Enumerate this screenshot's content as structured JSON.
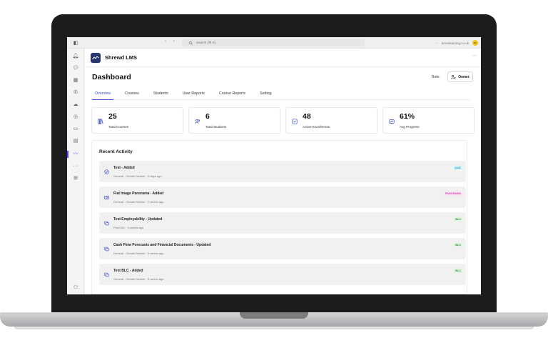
{
  "browser": {
    "search_placeholder": "Search (⌘ E)",
    "url": "leruelearning.co.uk",
    "avatar_initials": "SY",
    "nav_arrows": "‹ ›",
    "more": "···"
  },
  "app": {
    "name": "Shrewd LMS",
    "more": "···"
  },
  "page": {
    "title": "Dashboard",
    "role_label": "Role:",
    "role_value": "Owner"
  },
  "tabs": [
    {
      "label": "Overview",
      "active": true
    },
    {
      "label": "Courses",
      "active": false
    },
    {
      "label": "Students",
      "active": false
    },
    {
      "label": "User Reports",
      "active": false
    },
    {
      "label": "Course Reports",
      "active": false
    },
    {
      "label": "Setting",
      "active": false
    }
  ],
  "stats": [
    {
      "value": "25",
      "label": "Total Courses",
      "icon": "books-icon"
    },
    {
      "value": "6",
      "label": "Total Students",
      "icon": "users-icon"
    },
    {
      "value": "48",
      "label": "Active Enrollments",
      "icon": "check-square-icon"
    },
    {
      "value": "61%",
      "label": "Avg Progress",
      "icon": "chart-icon"
    }
  ],
  "activity": {
    "title": "Recent Activity",
    "items": [
      {
        "name": "Test - Added",
        "meta": "General - Growth Seeker · 5 days ago",
        "badge": "QUIZ",
        "badge_color": "#0ea5c6",
        "badge_bg": "#e3f6fb",
        "icon": "check-circle-icon"
      },
      {
        "name": "Flat Image Panorama - Added",
        "meta": "General - Growth Seeker · 2 weeks ago",
        "badge": "PANORAMA",
        "badge_color": "#d63fb1",
        "badge_bg": "#fbe6f5",
        "icon": "image-icon"
      },
      {
        "name": "Test Employability - Updated",
        "meta": "Prod 001 · 3 weeks ago",
        "badge": "BLC",
        "badge_color": "#2e8b37",
        "badge_bg": "#e4f5e4",
        "icon": "layers-icon"
      },
      {
        "name": "Cash Flow Forecasts and Financial Documents - Updated",
        "meta": "General - Growth Seeker · 3 weeks ago",
        "badge": "BLC",
        "badge_color": "#2e8b37",
        "badge_bg": "#e4f5e4",
        "icon": "layers-icon"
      },
      {
        "name": "Text BLC - Added",
        "meta": "General - Growth Seeker · 3 weeks ago",
        "badge": "BLC",
        "badge_color": "#2e8b37",
        "badge_bg": "#e4f5e4",
        "icon": "layers-icon"
      }
    ]
  },
  "colors": {
    "accent": "#3b4cca",
    "logo_bg": "#26366b"
  }
}
